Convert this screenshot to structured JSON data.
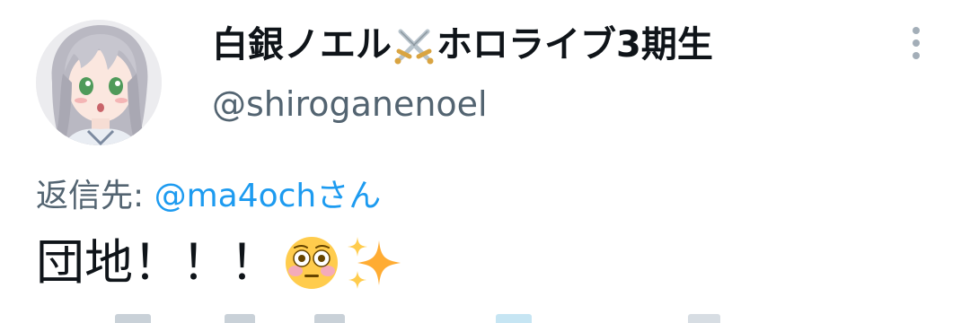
{
  "tweet": {
    "display_name": "白銀ノエル",
    "display_name_suffix": "ホロライブ3期生",
    "name_icon": "crossed-swords-icon",
    "handle": "@shiroganenoel",
    "reply_prefix": "返信先: ",
    "reply_to": "@ma4ochさん",
    "text": "団地！！！",
    "text_emojis": [
      "flushed-face-icon",
      "sparkles-icon"
    ],
    "more_icon": "more-vertical-icon"
  },
  "colors": {
    "name": "#0f1419",
    "secondary": "#536471",
    "link": "#1d9bf0",
    "more_dots": "#a3aeb8"
  }
}
